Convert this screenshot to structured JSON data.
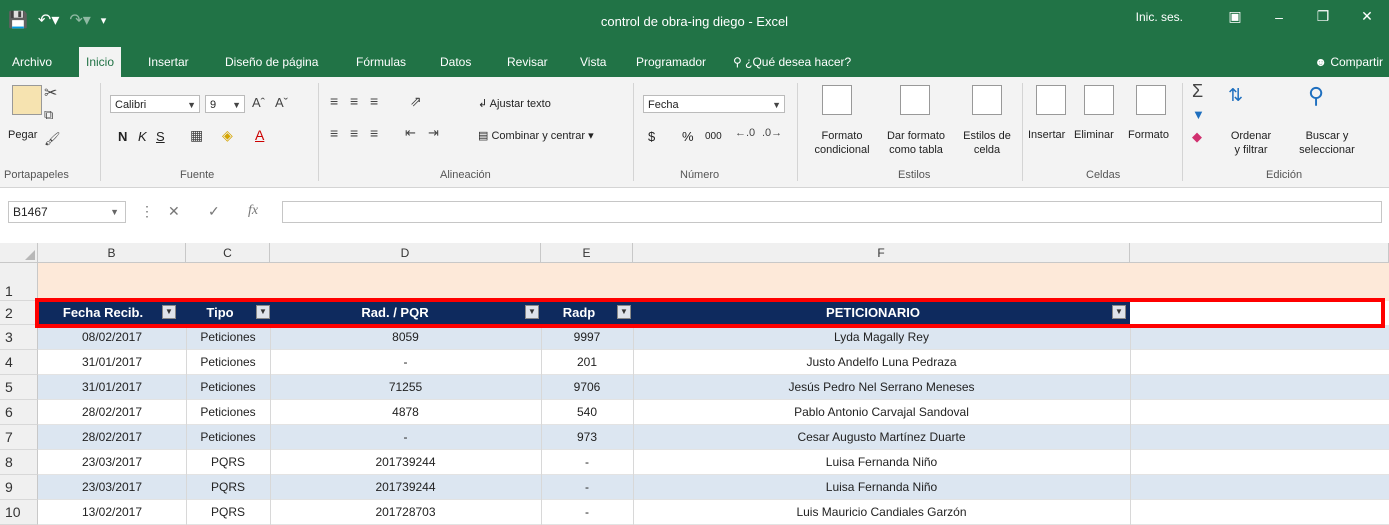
{
  "window": {
    "title": "control de obra-ing diego  -  Excel",
    "sign_in": "Inic. ses."
  },
  "menu": {
    "tabs": [
      "Archivo",
      "Inicio",
      "Insertar",
      "Diseño de página",
      "Fórmulas",
      "Datos",
      "Revisar",
      "Vista",
      "Programador"
    ],
    "search": "¿Qué desea hacer?",
    "share": "Compartir"
  },
  "ribbon": {
    "clipboard": {
      "paste": "Pegar",
      "label": "Portapapeles"
    },
    "font": {
      "name": "Calibri",
      "size": "9",
      "bold": "N",
      "italic": "K",
      "underline": "S",
      "label": "Fuente"
    },
    "alignment": {
      "wrap": "Ajustar texto",
      "merge": "Combinar y centrar",
      "label": "Alineación"
    },
    "number": {
      "format": "Fecha",
      "currency": "$",
      "percent": "%",
      "thousands": "000",
      "label": "Número"
    },
    "styles": {
      "conditional": [
        "Formato",
        "condicional"
      ],
      "as_table": [
        "Dar formato",
        "como tabla"
      ],
      "cell_styles": [
        "Estilos de",
        "celda"
      ],
      "label": "Estilos"
    },
    "cells": {
      "insert": "Insertar",
      "delete": "Eliminar",
      "format": "Formato",
      "label": "Celdas"
    },
    "editing": {
      "sort": [
        "Ordenar",
        "y filtrar"
      ],
      "find": [
        "Buscar y",
        "seleccionar"
      ],
      "label": "Edición"
    }
  },
  "formula_bar": {
    "name_box": "B1467",
    "fx": "fx",
    "value": ""
  },
  "grid": {
    "columns": [
      "B",
      "C",
      "D",
      "E",
      "F"
    ],
    "row_numbers": [
      "1",
      "2",
      "3",
      "4",
      "5",
      "6",
      "7",
      "8",
      "9",
      "10"
    ],
    "headers": [
      "Fecha Recib.",
      "Tipo",
      "Rad. / PQR",
      "Radp",
      "PETICIONARIO"
    ],
    "rows": [
      [
        "08/02/2017",
        "Peticiones",
        "8059",
        "9997",
        "Lyda Magally Rey"
      ],
      [
        "31/01/2017",
        "Peticiones",
        "-",
        "201",
        "Justo Andelfo Luna Pedraza"
      ],
      [
        "31/01/2017",
        "Peticiones",
        "71255",
        "9706",
        "Jesús Pedro Nel Serrano Meneses"
      ],
      [
        "28/02/2017",
        "Peticiones",
        "4878",
        "540",
        "Pablo Antonio Carvajal Sandoval"
      ],
      [
        "28/02/2017",
        "Peticiones",
        "-",
        "973",
        "Cesar Augusto Martínez Duarte"
      ],
      [
        "23/03/2017",
        "PQRS",
        "201739244",
        "-",
        "Luisa Fernanda Niño"
      ],
      [
        "23/03/2017",
        "PQRS",
        "201739244",
        "-",
        "Luisa Fernanda Niño"
      ],
      [
        "13/02/2017",
        "PQRS",
        "201728703",
        "-",
        "Luis Mauricio Candiales Garzón"
      ]
    ]
  },
  "colors": {
    "accent": "#217346",
    "header_fill": "#0e2a5e",
    "band_fill": "#dce6f1",
    "row1_fill": "#fde9d9",
    "highlight": "#ff0000"
  }
}
